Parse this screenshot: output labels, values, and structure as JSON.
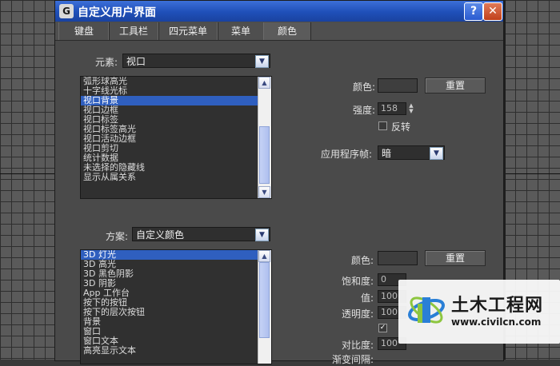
{
  "window": {
    "title": "自定义用户界面",
    "help_glyph": "?",
    "close_glyph": "✕"
  },
  "tabs": [
    {
      "label": "键盘"
    },
    {
      "label": "工具栏"
    },
    {
      "label": "四元菜单"
    },
    {
      "label": "菜单"
    },
    {
      "label": "颜色",
      "active": true
    }
  ],
  "elements": {
    "label": "元素:",
    "selected": "视口",
    "items": [
      "弧形球高光",
      "十字线光标",
      "视口背景",
      "视口边框",
      "视口标签",
      "视口标签高光",
      "视口活动边框",
      "视口剪切",
      "统计数据",
      "未选择的隐藏线",
      "显示从属关系"
    ],
    "selected_index": 2
  },
  "element_color": {
    "color_label": "颜色:",
    "reset_label": "重置",
    "intensity_label": "强度:",
    "intensity_value": "158",
    "invert_label": "反转",
    "app_frame_label": "应用程序帧:",
    "app_frame_value": "暗"
  },
  "scheme": {
    "label": "方案:",
    "selected": "自定义颜色",
    "items": [
      "3D 灯光",
      "3D 高光",
      "3D 黑色阴影",
      "3D 阴影",
      "App 工作台",
      "按下的按钮",
      "按下的层次按钮",
      "背景",
      "窗口",
      "窗口文本",
      "高亮显示文本"
    ],
    "selected_index": 0
  },
  "scheme_color": {
    "color_label": "颜色:",
    "reset_label": "重置",
    "saturation_label": "饱和度:",
    "saturation_value": "0",
    "value_label": "值:",
    "value_value": "100",
    "transparency_label": "透明度:",
    "transparency_value": "100",
    "contrast_label": "对比度:",
    "contrast_value": "100",
    "gradient_label": "渐变间隔:"
  },
  "watermark": {
    "name": "土木工程网",
    "url": "www.civilcn.com"
  },
  "colors": {
    "titlebar": "#1f4fb8",
    "selection": "#2f5fbf",
    "dialog_bg": "#4a4a4a"
  }
}
